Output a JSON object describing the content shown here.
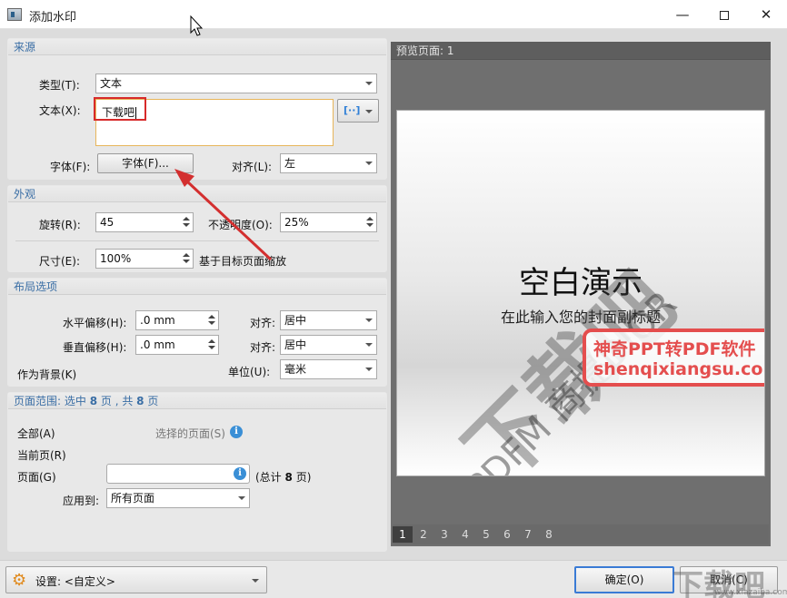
{
  "window": {
    "title": "添加水印",
    "min": "—",
    "close": "✕"
  },
  "source": {
    "header": "来源",
    "type_label": "类型(T):",
    "type_value": "文本",
    "text_label": "文本(X):",
    "text_value": "下载吧",
    "font_label": "字体(F):",
    "font_button": "字体(F)...",
    "align_label": "对齐(L):",
    "align_value": "左",
    "macro_icon": "[··]"
  },
  "appearance": {
    "header": "外观",
    "rotation_label": "旋转(R):",
    "rotation_value": "45",
    "opacity_label": "不透明度(O):",
    "opacity_value": "25%",
    "size_label": "尺寸(E):",
    "size_value": "100%",
    "scale_text": "基于目标页面缩放"
  },
  "layout": {
    "header": "布局选项",
    "h_offset_label": "水平偏移(H):",
    "h_offset_value": ".0 mm",
    "v_offset_label": "垂直偏移(H):",
    "v_offset_value": ".0 mm",
    "align1_label": "对齐:",
    "align1_value": "居中",
    "align2_label": "对齐:",
    "align2_value": "居中",
    "background_label": "作为背景(K)",
    "unit_label": "单位(U):",
    "unit_value": "毫米"
  },
  "range": {
    "header_prefix": "页面范围: 选中",
    "selected": "8",
    "header_mid": "页 , 共",
    "total": "8",
    "header_suffix": "页",
    "all_label": "全部(A)",
    "selected_pages_label": "选择的页面(S)",
    "current_label": "当前页(R)",
    "pages_label": "页面(G)",
    "pages_value": "",
    "total_prefix": "(总计",
    "total_count": "8",
    "total_suffix": "页)",
    "apply_label": "应用到:",
    "apply_value": "所有页面",
    "info_glyph": "i"
  },
  "preview": {
    "header": "预览页面: 1",
    "slide_title": "空白演示",
    "slide_subtitle": "在此输入您的封面副标题",
    "watermark_main": "下载吧",
    "watermark_small": "PDFM 商提DIOR",
    "stamp_line1": "神奇PPT转PDF软件",
    "stamp_line2": "shenqixiangsu.com",
    "pages": [
      "1",
      "2",
      "3",
      "4",
      "5",
      "6",
      "7",
      "8"
    ],
    "active_page": "1"
  },
  "bottom": {
    "settings_label": "设置: <自定义>",
    "ok": "确定(O)",
    "cancel": "取消(C)",
    "corner_watermark": "下载吧",
    "corner_watermark_sub": "www.xiazaiba.com"
  },
  "colors": {
    "accent": "#3a6ea5",
    "highlight": "#d72a2a",
    "stamp": "#e44e4e",
    "arrow": "#d32f2f"
  },
  "icons": {
    "settings": "gear-icon",
    "info": "info-icon",
    "macro": "macro-icon"
  }
}
